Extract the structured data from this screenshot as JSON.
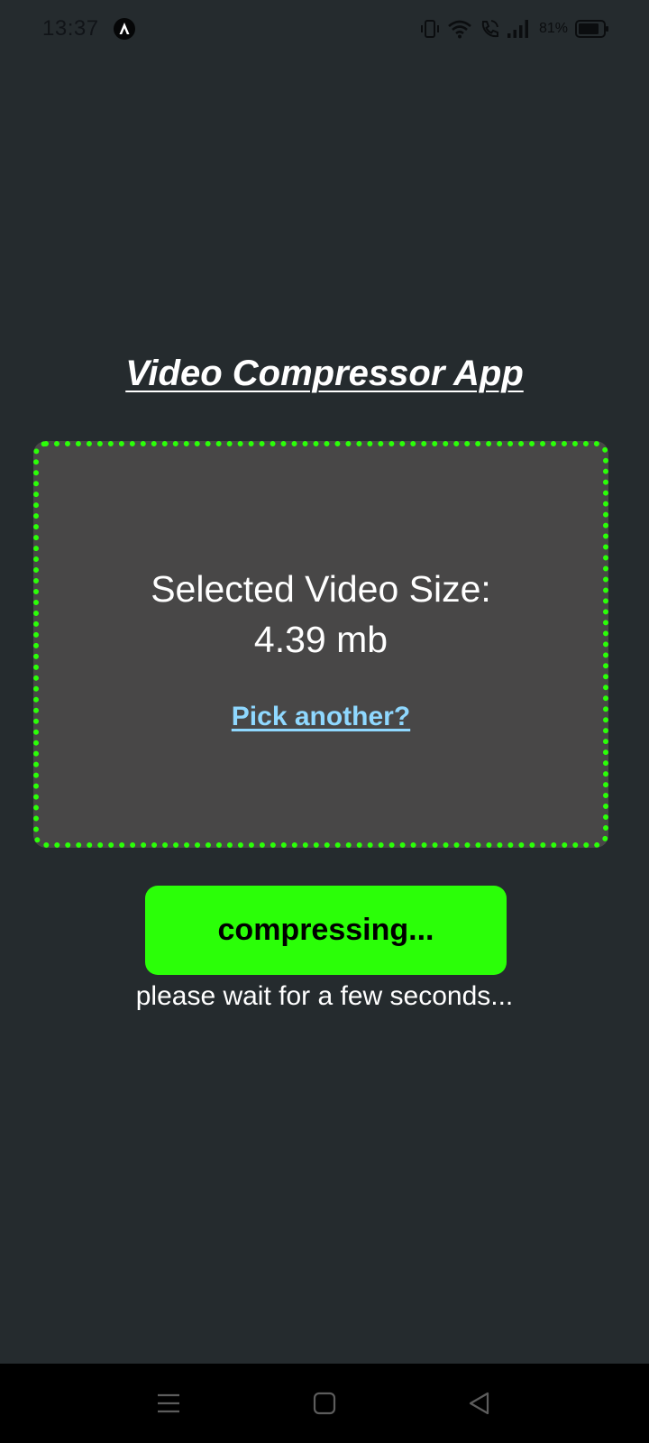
{
  "status_bar": {
    "time": "13:37",
    "battery_percent": "81%",
    "icons": [
      "app-notification-icon",
      "vibrate-icon",
      "wifi-icon",
      "wifi-calling-icon",
      "signal-icon",
      "battery-icon"
    ]
  },
  "app": {
    "title": "Video Compressor App"
  },
  "card": {
    "size_label": "Selected Video Size:",
    "size_value": "4.39 mb",
    "pick_another": "Pick another?"
  },
  "compress": {
    "button_label": "compressing...",
    "wait_message": "please wait for a few seconds..."
  },
  "nav_bar": {
    "icons": [
      "menu-icon",
      "home-icon",
      "back-icon"
    ]
  },
  "colors": {
    "background": "#252B2E",
    "card_background": "#484747",
    "accent_green": "#2BFF08",
    "link_blue": "#8FD8FF",
    "text_white": "#FFFFFF",
    "nav_background": "#000000"
  }
}
